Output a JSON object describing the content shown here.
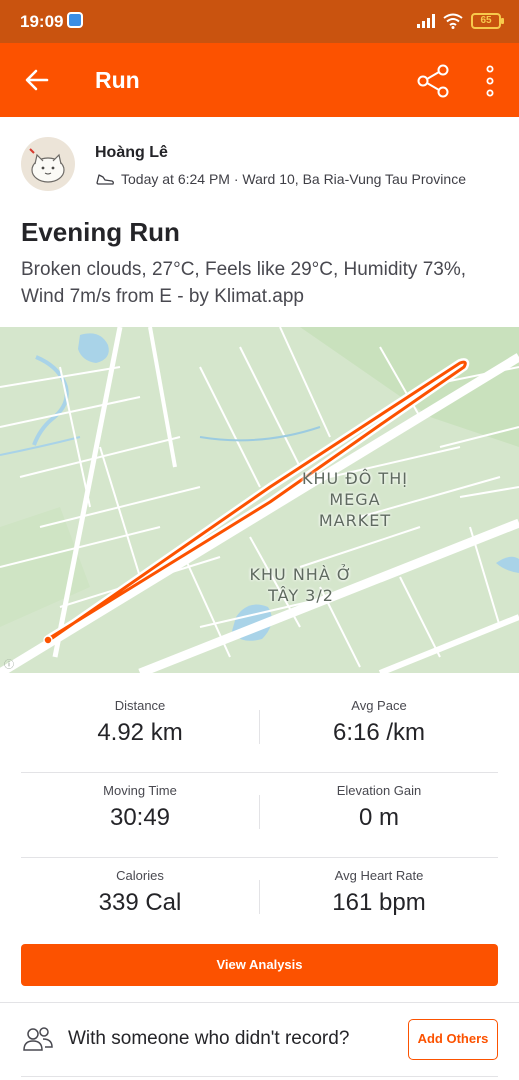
{
  "status_bar": {
    "time": "19:09",
    "battery": "65"
  },
  "app_bar": {
    "title": "Run"
  },
  "athlete": {
    "name": "Hoàng Lê",
    "meta": "Today at 6:24 PM · Ward 10, Ba Ria-Vung Tau Province"
  },
  "activity": {
    "title": "Evening Run",
    "description": "Broken clouds, 27°C, Feels like 29°C, Humidity 73%, Wind 7m/s from E - by Klimat.app"
  },
  "map": {
    "labels": [
      "KHU ĐÔ THỊ MEGA MARKET",
      "KHU NHÀ Ở TÂY 3/2"
    ],
    "route_color": "#fc5200"
  },
  "stats": [
    {
      "label": "Distance",
      "value": "4.92 km"
    },
    {
      "label": "Avg Pace",
      "value": "6:16 /km"
    },
    {
      "label": "Moving Time",
      "value": "30:49"
    },
    {
      "label": "Elevation Gain",
      "value": "0 m"
    },
    {
      "label": "Calories",
      "value": "339 Cal"
    },
    {
      "label": "Avg Heart Rate",
      "value": "161 bpm"
    }
  ],
  "actions": {
    "view_analysis": "View Analysis",
    "others_prompt": "With someone who didn't record?",
    "add_others": "Add Others"
  },
  "colors": {
    "brand": "#fc5200",
    "status_bar": "#c9530f"
  }
}
